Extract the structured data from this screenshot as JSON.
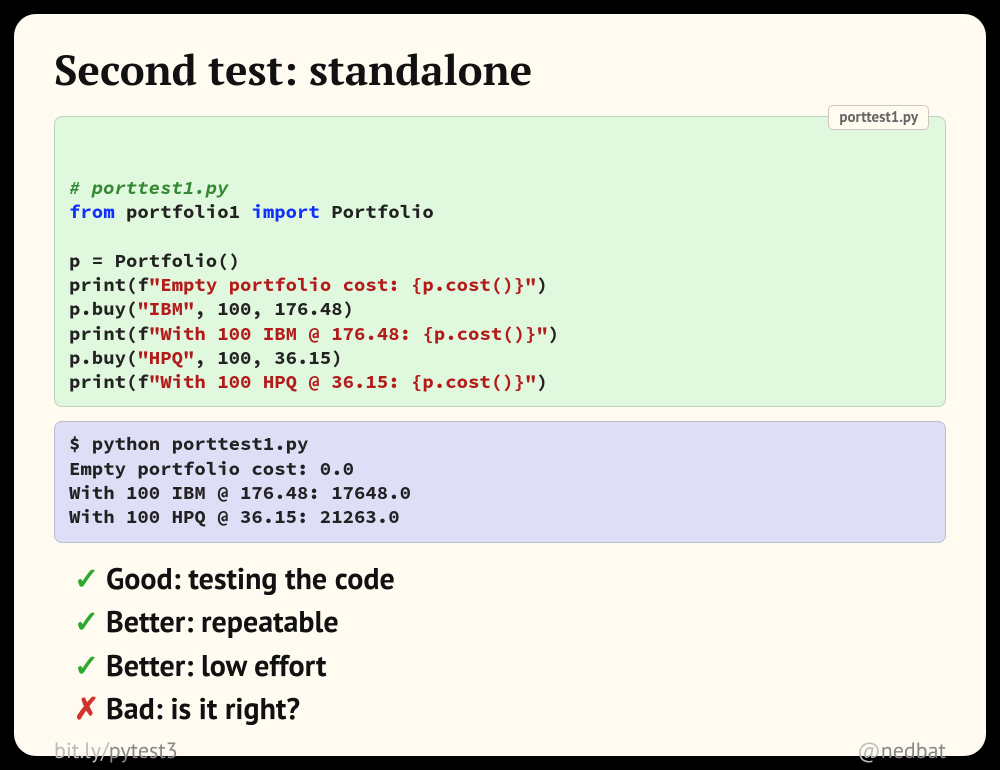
{
  "title": "Second test: standalone",
  "code": {
    "tag": "porttest1.py",
    "l1_comment": "# porttest1.py",
    "l2_from": "from",
    "l2_mod": " portfolio1 ",
    "l2_imp": "import",
    "l2_name": " Portfolio",
    "l3_blank": "",
    "l4": "p = Portfolio()",
    "l5_print": "print",
    "l5_f": "(f",
    "l5_s1": "\"Empty portfolio cost: ",
    "l5_i": "{p.cost()}",
    "l5_s2": "\"",
    "l5_close": ")",
    "l6_a": "p.buy(",
    "l6_s": "\"IBM\"",
    "l6_b": ", 100, 176.48)",
    "l7_print": "print",
    "l7_f": "(f",
    "l7_s1": "\"With 100 IBM @ 176.48: ",
    "l7_i": "{p.cost()}",
    "l7_s2": "\"",
    "l7_close": ")",
    "l8_a": "p.buy(",
    "l8_s": "\"HPQ\"",
    "l8_b": ", 100, 36.15)",
    "l9_print": "print",
    "l9_f": "(f",
    "l9_s1": "\"With 100 HPQ @ 36.15: ",
    "l9_i": "{p.cost()}",
    "l9_s2": "\"",
    "l9_close": ")"
  },
  "shell": {
    "l1": "$ python porttest1.py",
    "l2": "Empty portfolio cost: 0.0",
    "l3": "With 100 IBM @ 176.48: 17648.0",
    "l4": "With 100 HPQ @ 36.15: 21263.0"
  },
  "bullets": {
    "b1": "Good: testing the code",
    "b2": "Better: repeatable",
    "b3": "Better: low effort",
    "b4": "Bad: is it right?"
  },
  "marks": {
    "check": "✓",
    "cross": "✗"
  },
  "footer": {
    "left_dim": "bit.ly/",
    "left_bold": "pytest3",
    "right_dim": "@",
    "right_bold": "nedbat"
  }
}
